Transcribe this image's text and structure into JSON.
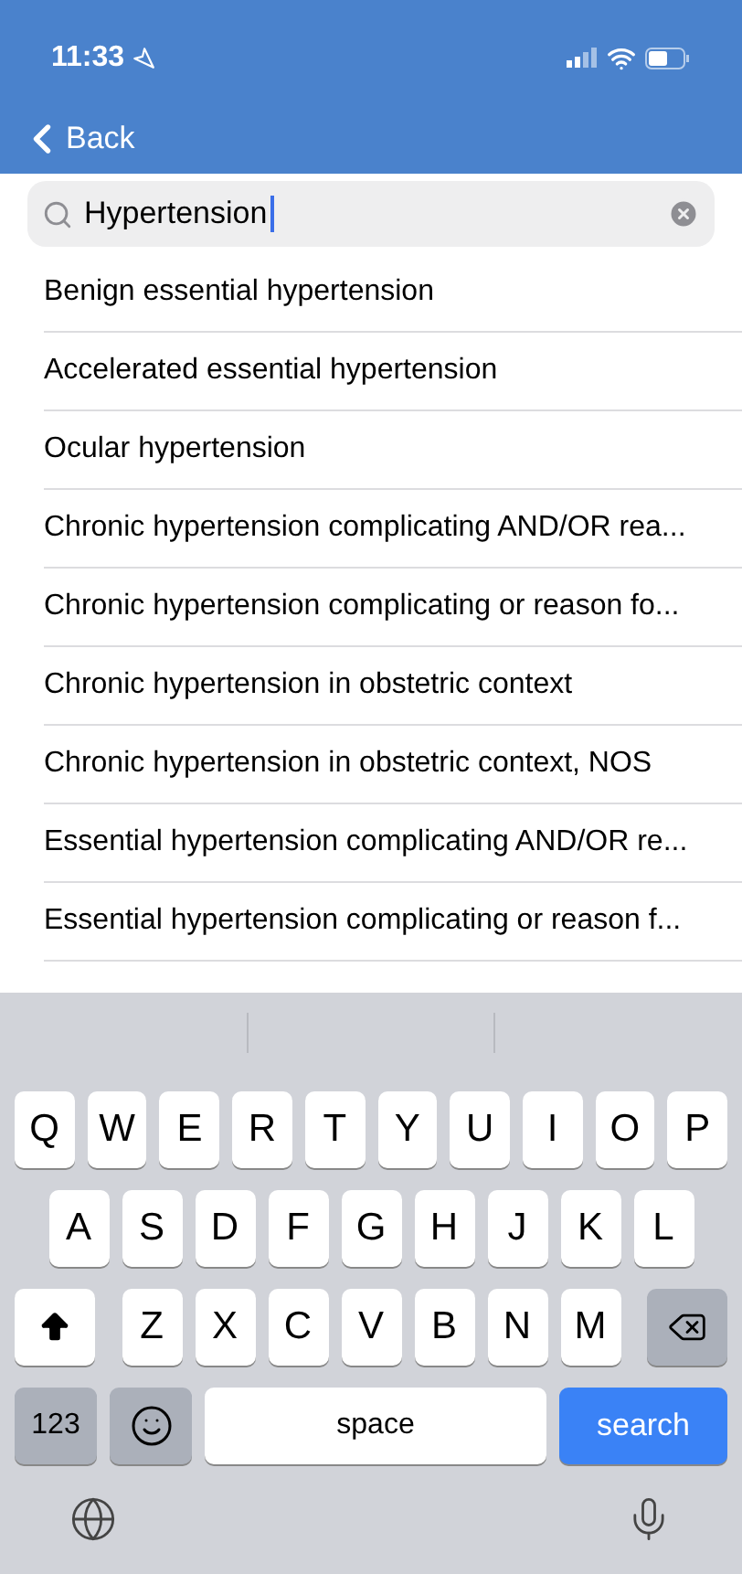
{
  "status_bar": {
    "time": "11:33"
  },
  "nav": {
    "back_label": "Back"
  },
  "search": {
    "value": "Hypertension"
  },
  "results": [
    "Benign essential hypertension",
    "Accelerated essential hypertension",
    "Ocular hypertension",
    "Chronic hypertension complicating AND/OR rea...",
    "Chronic hypertension complicating or reason fo...",
    "Chronic hypertension in obstetric context",
    "Chronic hypertension in obstetric context, NOS",
    "Essential hypertension complicating AND/OR re...",
    "Essential hypertension complicating or reason f..."
  ],
  "keyboard": {
    "rows": [
      [
        {
          "kind": "letter",
          "label": "Q"
        },
        {
          "kind": "letter",
          "label": "W"
        },
        {
          "kind": "letter",
          "label": "E"
        },
        {
          "kind": "letter",
          "label": "R"
        },
        {
          "kind": "letter",
          "label": "T"
        },
        {
          "kind": "letter",
          "label": "Y"
        },
        {
          "kind": "letter",
          "label": "U"
        },
        {
          "kind": "letter",
          "label": "I"
        },
        {
          "kind": "letter",
          "label": "O"
        },
        {
          "kind": "letter",
          "label": "P"
        }
      ],
      [
        {
          "kind": "letter",
          "label": "A"
        },
        {
          "kind": "letter",
          "label": "S"
        },
        {
          "kind": "letter",
          "label": "D"
        },
        {
          "kind": "letter",
          "label": "F"
        },
        {
          "kind": "letter",
          "label": "G"
        },
        {
          "kind": "letter",
          "label": "H"
        },
        {
          "kind": "letter",
          "label": "J"
        },
        {
          "kind": "letter",
          "label": "K"
        },
        {
          "kind": "letter",
          "label": "L"
        }
      ],
      [
        {
          "kind": "shift"
        },
        {
          "kind": "letter",
          "label": "Z"
        },
        {
          "kind": "letter",
          "label": "X"
        },
        {
          "kind": "letter",
          "label": "C"
        },
        {
          "kind": "letter",
          "label": "V"
        },
        {
          "kind": "letter",
          "label": "B"
        },
        {
          "kind": "letter",
          "label": "N"
        },
        {
          "kind": "letter",
          "label": "M"
        },
        {
          "kind": "delete"
        }
      ]
    ],
    "bottom_bar": {
      "numbers_label": "123",
      "space_label": "space",
      "search_label": "search"
    }
  }
}
